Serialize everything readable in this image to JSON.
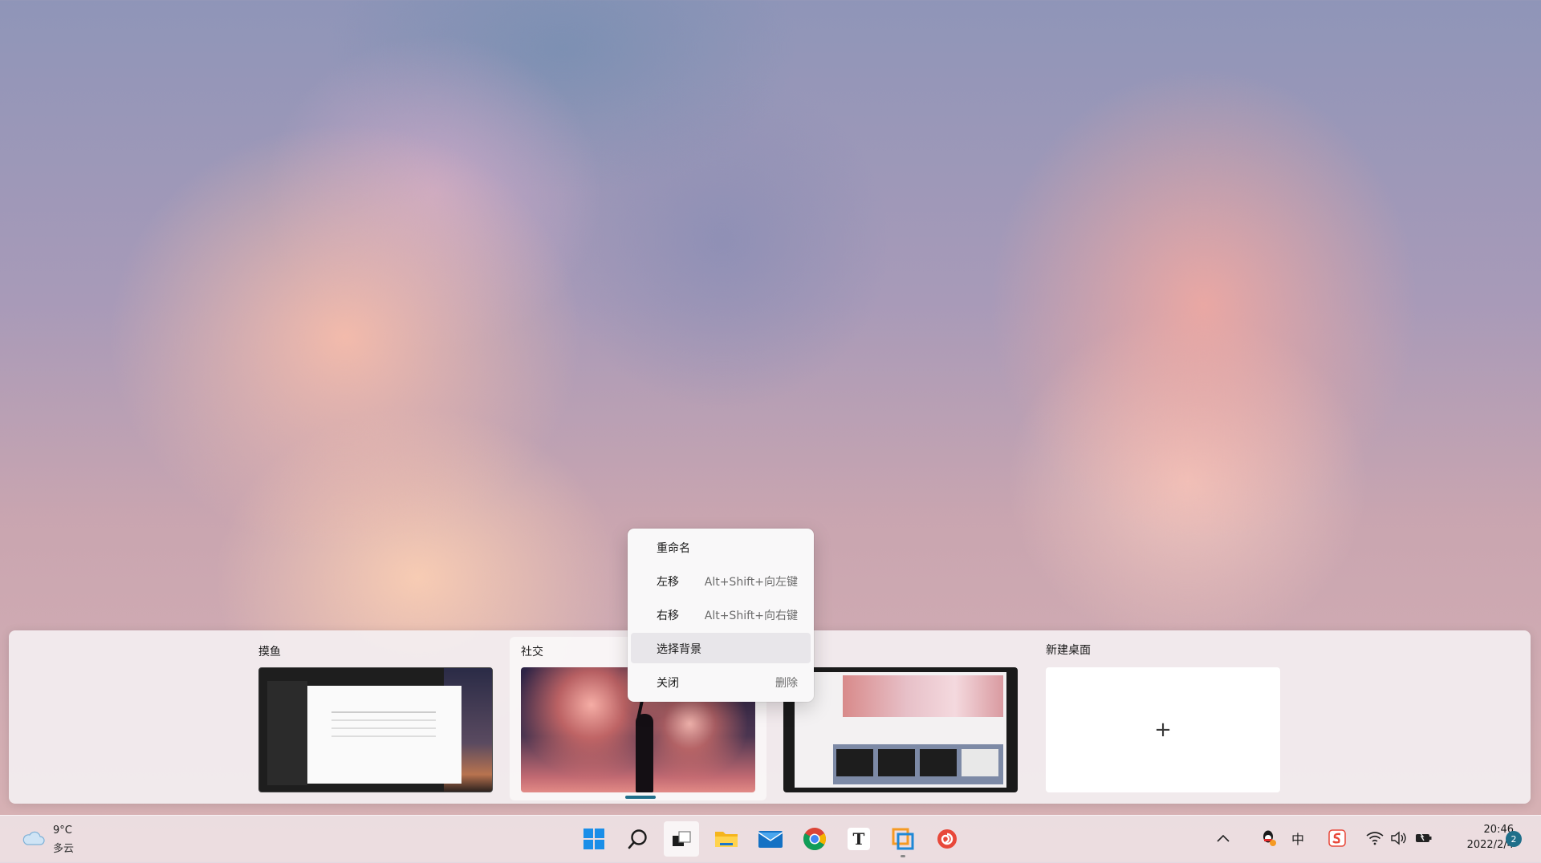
{
  "task_view": {
    "desktops": [
      {
        "name": "摸鱼"
      },
      {
        "name": "社交"
      },
      {
        "name": ""
      },
      {
        "name": "新建桌面"
      }
    ],
    "new_desktop_symbol": "+"
  },
  "context_menu": {
    "items": [
      {
        "label": "重命名",
        "shortcut": ""
      },
      {
        "label": "左移",
        "shortcut": "Alt+Shift+向左键"
      },
      {
        "label": "右移",
        "shortcut": "Alt+Shift+向右键"
      },
      {
        "label": "选择背景",
        "shortcut": ""
      },
      {
        "label": "关闭",
        "shortcut": "删除"
      }
    ],
    "hovered_item": "选择背景"
  },
  "taskbar": {
    "weather": {
      "temp": "9°C",
      "condition": "多云",
      "icon": "cloud-icon"
    },
    "apps": [
      {
        "name": "start",
        "icon": "windows-start-icon"
      },
      {
        "name": "search",
        "icon": "search-icon"
      },
      {
        "name": "task-view",
        "icon": "task-view-icon"
      },
      {
        "name": "file-explorer",
        "icon": "folder-icon"
      },
      {
        "name": "mail",
        "icon": "mail-icon"
      },
      {
        "name": "chrome",
        "icon": "chrome-icon"
      },
      {
        "name": "typora",
        "icon": "typora-icon",
        "glyph": "T"
      },
      {
        "name": "virtual-machine",
        "icon": "vm-icon"
      },
      {
        "name": "snail-app",
        "icon": "snail-icon"
      }
    ],
    "tray": {
      "chevron": "^",
      "ime": "中",
      "icons": [
        "qq-icon",
        "ime-icon",
        "sogou-icon",
        "wifi-icon",
        "volume-icon",
        "battery-icon"
      ]
    },
    "clock": {
      "time": "20:46",
      "date": "2022/2/4"
    },
    "notification_count": "2"
  },
  "colors": {
    "accent": "#1f6f8a",
    "windows_blue": "#1a8ee8"
  }
}
